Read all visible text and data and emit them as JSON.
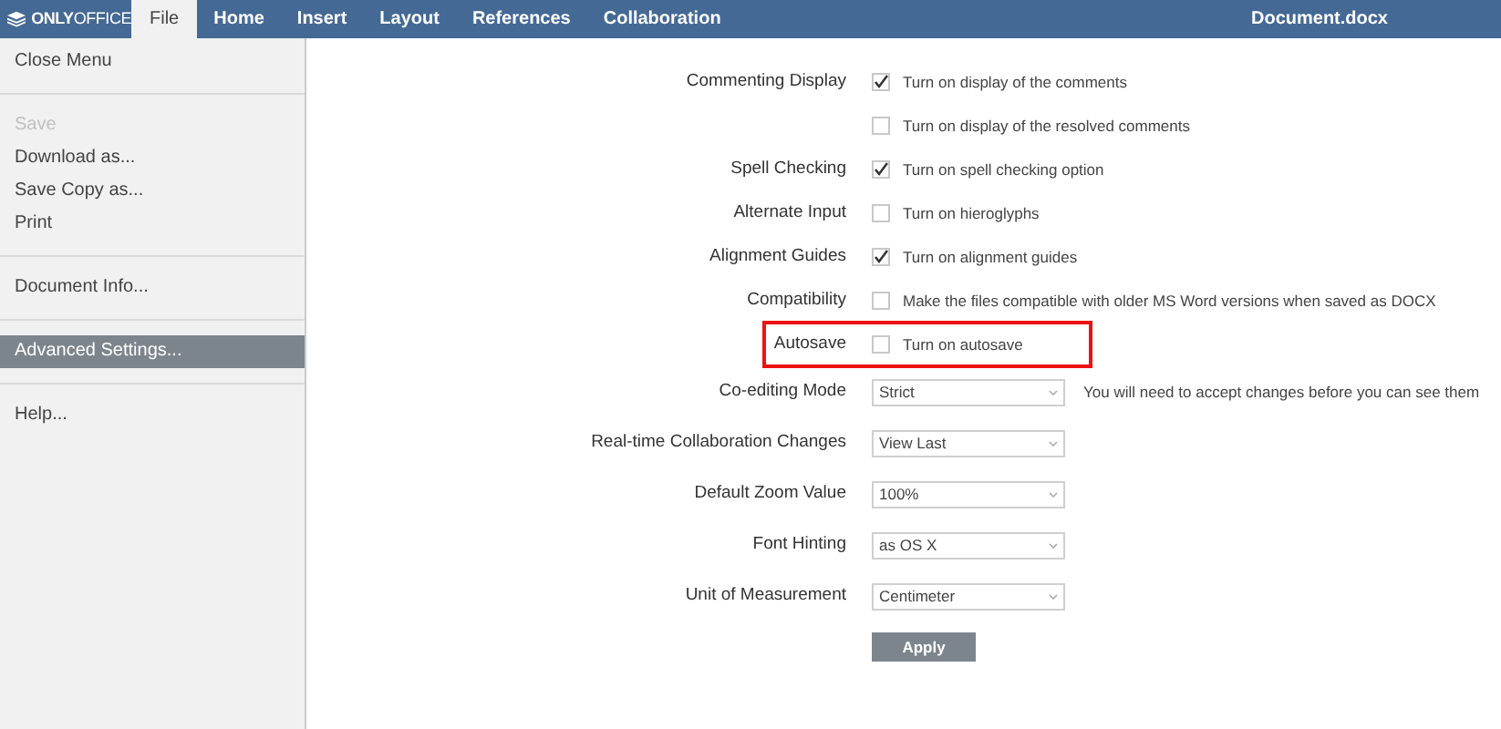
{
  "logo": {
    "text": "**ONLY**OFFICE"
  },
  "tabs": [
    {
      "label": "File",
      "selected": true
    },
    {
      "label": "Home",
      "selected": false
    },
    {
      "label": "Insert",
      "selected": false
    },
    {
      "label": "Layout",
      "selected": false
    },
    {
      "label": "References",
      "selected": false
    },
    {
      "label": "Collaboration",
      "selected": false
    }
  ],
  "document_title": "Document.docx",
  "menu": [
    {
      "label": "Close Menu",
      "selected": false,
      "disabled": false,
      "divider_after": true
    },
    {
      "label": "Save",
      "selected": false,
      "disabled": true,
      "divider_after": false
    },
    {
      "label": "Download as...",
      "selected": false,
      "disabled": false,
      "divider_after": false
    },
    {
      "label": "Save Copy as...",
      "selected": false,
      "disabled": false,
      "divider_after": false
    },
    {
      "label": "Print",
      "selected": false,
      "disabled": false,
      "divider_after": true
    },
    {
      "label": "Document Info...",
      "selected": false,
      "disabled": false,
      "divider_after": true
    },
    {
      "label": "Advanced Settings...",
      "selected": true,
      "disabled": false,
      "divider_after": true
    },
    {
      "label": "Help...",
      "selected": false,
      "disabled": false,
      "divider_after": false
    }
  ],
  "settings": [
    {
      "kind": "checkbox",
      "label": "Commenting Display",
      "checked": true,
      "text": "Turn on display of the comments",
      "highlighted": false
    },
    {
      "kind": "checkbox",
      "checked": false,
      "text": "Turn on display of the resolved comments",
      "highlighted": false
    },
    {
      "kind": "checkbox",
      "label": "Spell Checking",
      "checked": true,
      "text": "Turn on spell checking option",
      "highlighted": false
    },
    {
      "kind": "checkbox",
      "label": "Alternate Input",
      "checked": false,
      "text": "Turn on hieroglyphs",
      "highlighted": false
    },
    {
      "kind": "checkbox",
      "label": "Alignment Guides",
      "checked": true,
      "text": "Turn on alignment guides",
      "highlighted": false
    },
    {
      "kind": "checkbox",
      "label": "Compatibility",
      "checked": false,
      "text": "Make the files compatible with older MS Word versions when saved as DOCX",
      "highlighted": false
    },
    {
      "kind": "checkbox",
      "label": "Autosave",
      "checked": false,
      "text": "Turn on autosave",
      "highlighted": true
    },
    {
      "kind": "select",
      "label": "Co-editing Mode",
      "value": "Strict",
      "note": "You will need to accept changes before you can see them"
    },
    {
      "kind": "select",
      "label": "Real-time Collaboration Changes",
      "value": "View Last"
    },
    {
      "kind": "select",
      "label": "Default Zoom Value",
      "value": "100%"
    },
    {
      "kind": "select",
      "label": "Font Hinting",
      "value": "as OS X"
    },
    {
      "kind": "select",
      "label": "Unit of Measurement",
      "value": "Centimeter"
    },
    {
      "kind": "button",
      "text": "Apply"
    }
  ]
}
